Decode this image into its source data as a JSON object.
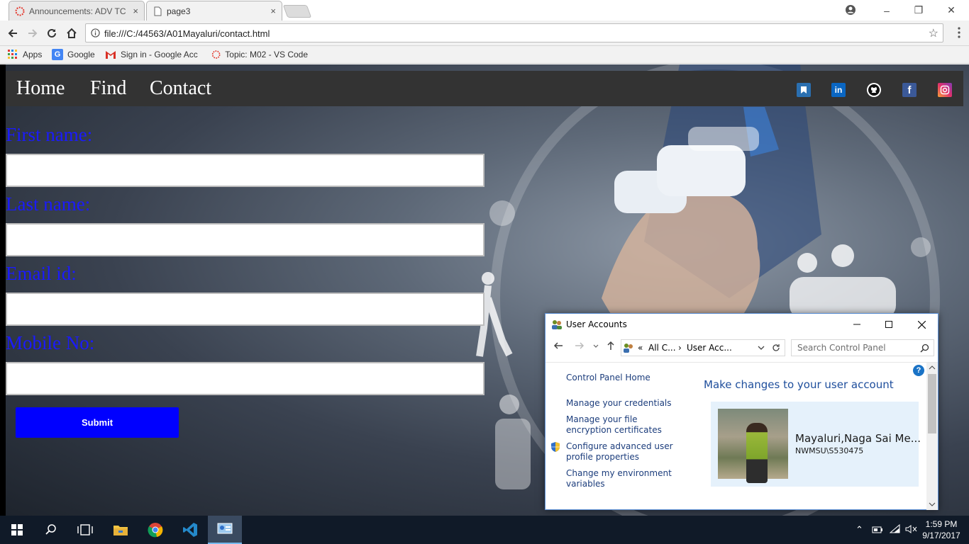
{
  "browser": {
    "tabs": [
      {
        "title": "Announcements: ADV TC",
        "close": "×"
      },
      {
        "title": "page3",
        "close": "×"
      }
    ],
    "address": "file:///C:/44563/A01Mayaluri/contact.html",
    "window_controls": {
      "minimize": "–",
      "restore": "❐",
      "close": "✕"
    }
  },
  "bookmarks": [
    {
      "label": "Apps",
      "icon": "apps-grid-icon"
    },
    {
      "label": "Google",
      "icon": "google-icon"
    },
    {
      "label": "Sign in - Google Acc",
      "icon": "gmail-icon"
    },
    {
      "label": "Topic: M02 - VS Code",
      "icon": "canvas-icon"
    }
  ],
  "site": {
    "nav": [
      "Home",
      "Find",
      "Contact"
    ],
    "social": [
      "bookmark-icon",
      "linkedin-icon",
      "github-icon",
      "facebook-icon",
      "instagram-icon"
    ],
    "form": {
      "fields": [
        {
          "label": "First name:",
          "value": ""
        },
        {
          "label": "Last name:",
          "value": ""
        },
        {
          "label": "Email id:",
          "value": ""
        },
        {
          "label": "Mobile No:",
          "value": ""
        }
      ],
      "submit": "Submit"
    },
    "accent": "#0000ff"
  },
  "user_accounts": {
    "title": "User Accounts",
    "breadcrumb": {
      "prefix": "«",
      "part1": "All C...",
      "sep": "›",
      "part2": "User Acc..."
    },
    "search_placeholder": "Search Control Panel",
    "links": {
      "home": "Control Panel Home",
      "credentials": "Manage your credentials",
      "encryption": "Manage your file encryption certificates",
      "advanced": "Configure advanced user profile properties",
      "env": "Change my environment variables"
    },
    "heading": "Make changes to your user account",
    "user": {
      "name": "Mayaluri,Naga Sai Me...",
      "domain": "NWMSU\\S530475"
    },
    "help": "?"
  },
  "taskbar": {
    "time": "1:59 PM",
    "date": "9/17/2017"
  }
}
